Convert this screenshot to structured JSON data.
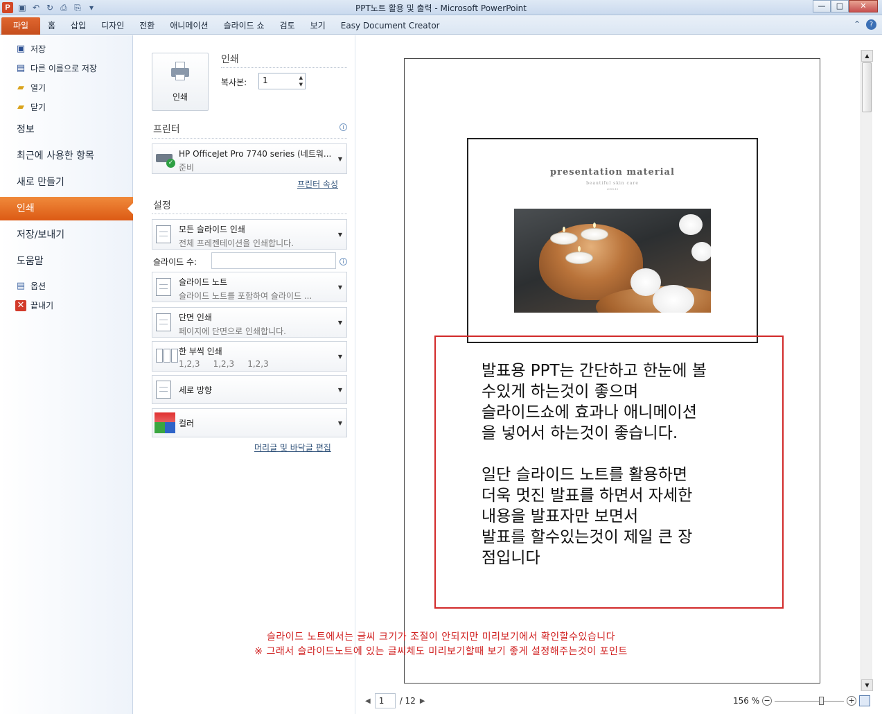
{
  "window": {
    "title": "PPT노트 활용 및 출력 - Microsoft PowerPoint",
    "app_icon_letter": "P",
    "buttons": {
      "minimize": "—",
      "maximize": "□",
      "close": "✕"
    }
  },
  "ribbon": {
    "file_tab": "파일",
    "tabs": [
      "홈",
      "삽입",
      "디자인",
      "전환",
      "애니메이션",
      "슬라이드 쇼",
      "검토",
      "보기",
      "Easy Document Creator"
    ],
    "help": "?"
  },
  "nav": {
    "save": "저장",
    "save_as": "다른 이름으로 저장",
    "open": "열기",
    "close": "닫기",
    "info": "정보",
    "recent": "최근에 사용한 항목",
    "new": "새로 만들기",
    "print": "인쇄",
    "save_send": "저장/보내기",
    "help": "도움말",
    "options": "옵션",
    "exit": "끝내기"
  },
  "print_panel": {
    "print_button": "인쇄",
    "print_heading": "인쇄",
    "copies_label": "복사본:",
    "copies_value": "1",
    "printer_heading": "프린터",
    "printer_name": "HP OfficeJet Pro 7740 series (네트워...",
    "printer_status": "준비",
    "printer_properties": "프린터 속성",
    "settings_heading": "설정",
    "slides_range_title": "모든 슬라이드 인쇄",
    "slides_range_desc": "전체 프레젠테이션을 인쇄합니다.",
    "slides_label": "슬라이드 수:",
    "slides_value": "",
    "layout_title": "슬라이드 노트",
    "layout_desc": "슬라이드 노트를 포함하여 슬라이드 ...",
    "sides_title": "단면 인쇄",
    "sides_desc": "페이지에 단면으로 인쇄합니다.",
    "collate_title": "한 부씩 인쇄",
    "collate_desc": "1,2,3     1,2,3     1,2,3",
    "orientation_title": "세로 방향",
    "color_title": "컬러",
    "header_footer_link": "머리글 및 바닥글 편집"
  },
  "preview": {
    "slide_title": "presentation  material",
    "slide_subtitle": "beautiful skin care",
    "slide_subtitle2": "2018.10",
    "notes_para1": "발표용 PPT는 간단하고 한눈에 볼\n수있게 하는것이 좋으며\n슬라이드쇼에 효과나 애니메이션\n을 넣어서 하는것이 좋습니다.",
    "notes_para2": "일단 슬라이드 노트를 활용하면\n더욱 멋진 발표를 하면서 자세한\n내용을 발표자만 보면서\n발표를 할수있는것이 제일 큰 장\n점입니다",
    "annotation_line1": "슬라이드 노트에서는 글씨 크기가 조절이 안되지만 미리보기에서 확인할수있습니다",
    "annotation_line2": "※ 그래서 슬라이드노트에 있는 글씨체도 미리보기할때 보기 좋게 설정해주는것이 포인트",
    "page_current": "1",
    "page_total": "/ 12",
    "zoom_level": "156 %"
  },
  "colors": {
    "file_tab": "#d24726",
    "active_nav": "#dc5a14",
    "notes_border": "#d22a2a",
    "annotation": "#d02020"
  }
}
